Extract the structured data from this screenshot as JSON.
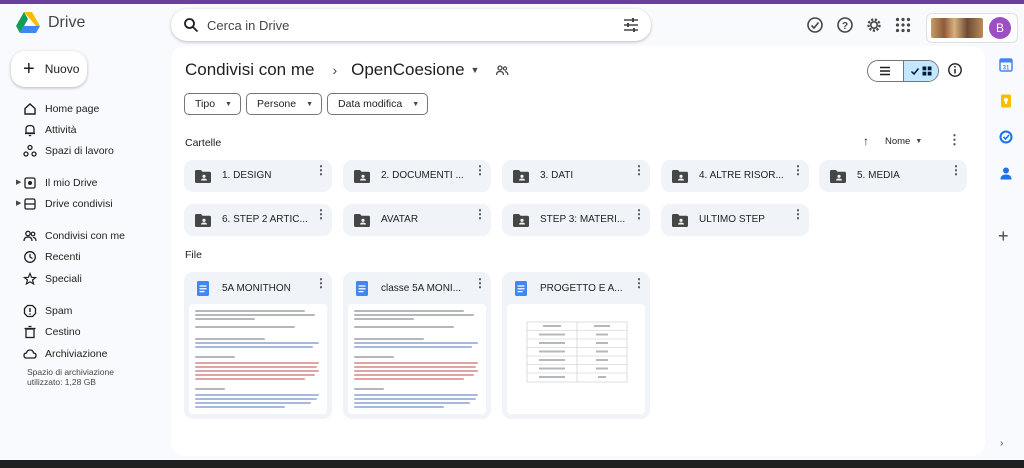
{
  "app": {
    "name": "Drive"
  },
  "search": {
    "placeholder": "Cerca in Drive",
    "value": ""
  },
  "new_button": {
    "label": "Nuovo"
  },
  "sidebar": {
    "items": [
      {
        "label": "Home page",
        "icon": "home-icon"
      },
      {
        "label": "Attività",
        "icon": "bell-icon"
      },
      {
        "label": "Spazi di lavoro",
        "icon": "workspaces-icon"
      },
      {
        "label": "Il mio Drive",
        "icon": "my-drive-icon"
      },
      {
        "label": "Drive condivisi",
        "icon": "shared-drives-icon"
      },
      {
        "label": "Condivisi con me",
        "icon": "people-icon"
      },
      {
        "label": "Recenti",
        "icon": "clock-icon"
      },
      {
        "label": "Speciali",
        "icon": "star-icon"
      },
      {
        "label": "Spam",
        "icon": "spam-icon"
      },
      {
        "label": "Cestino",
        "icon": "trash-icon"
      },
      {
        "label": "Archiviazione",
        "icon": "cloud-icon"
      }
    ],
    "storage": "Spazio di archiviazione utilizzato: 1,28 GB"
  },
  "breadcrumb": {
    "root": "Condivisi con me",
    "current": "OpenCoesione"
  },
  "filters": [
    "Tipo",
    "Persone",
    "Data modifica"
  ],
  "sections": {
    "folders_title": "Cartelle",
    "files_title": "File"
  },
  "sort": {
    "label": "Nome"
  },
  "folders": [
    "1. DESIGN",
    "2. DOCUMENTI ...",
    "3. DATI",
    "4. ALTRE RISOR...",
    "5. MEDIA",
    "6. STEP 2 ARTIC...",
    "AVATAR",
    "STEP 3: MATERI...",
    "ULTIMO STEP"
  ],
  "files": [
    {
      "name": "5A MONITHON",
      "type": "doc"
    },
    {
      "name": "classe 5A MONI...",
      "type": "doc"
    },
    {
      "name": "PROGETTO E A...",
      "type": "doc"
    }
  ],
  "account": {
    "initial": "B",
    "avatar_color": "#9c4fc4"
  },
  "colors": {
    "accent": "#0b57d0",
    "selected_toggle": "#c2e7ff",
    "doc_blue": "#4285f4",
    "top_strip": "#6b3fa0"
  }
}
